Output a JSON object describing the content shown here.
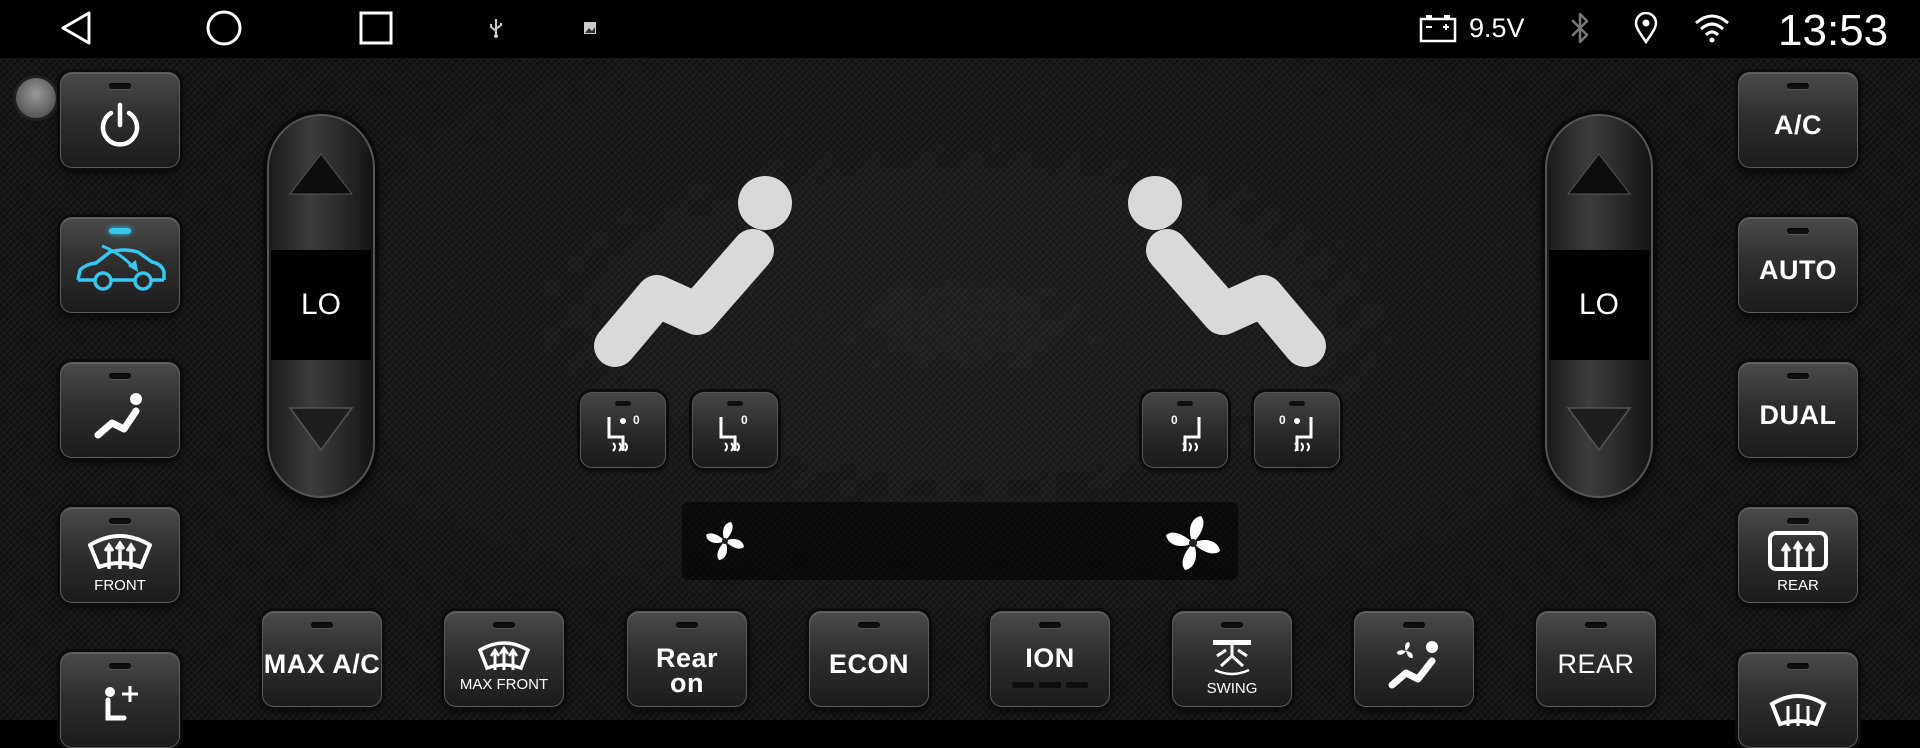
{
  "statusbar": {
    "icons": [
      "back-icon",
      "home-icon",
      "recents-icon",
      "usb-icon",
      "image-icon",
      "battery-icon",
      "bluetooth-icon",
      "location-icon",
      "wifi-icon"
    ],
    "voltage": "9.5V",
    "time": "13:53"
  },
  "left_column": {
    "buttons": [
      {
        "name": "power-button",
        "icon": "power-icon"
      },
      {
        "name": "recirculation-button",
        "icon": "car-recirculation-icon",
        "active": true
      },
      {
        "name": "seat-airflow-button",
        "icon": "seat-person-icon"
      },
      {
        "name": "front-defrost-button",
        "icon": "front-defrost-icon",
        "label": "FRONT"
      },
      {
        "name": "seat-add-button",
        "icon": "seat-plus-icon"
      }
    ]
  },
  "right_column": {
    "buttons": [
      {
        "name": "ac-button",
        "label": "A/C"
      },
      {
        "name": "auto-button",
        "label": "AUTO"
      },
      {
        "name": "dual-button",
        "label": "DUAL"
      },
      {
        "name": "rear-defrost-button",
        "icon": "rear-defrost-icon",
        "label": "REAR"
      },
      {
        "name": "defrost-button",
        "icon": "front-defrost-icon"
      }
    ]
  },
  "temperature": {
    "left": {
      "value": "LO"
    },
    "right": {
      "value": "LO"
    }
  },
  "seat_heat": {
    "left": [
      {
        "name": "seat-vent-left",
        "level": "0",
        "icon": "seat-fan-icon"
      },
      {
        "name": "seat-heat-left",
        "level": "0",
        "icon": "seat-heat-icon"
      }
    ],
    "right": [
      {
        "name": "seat-heat-right",
        "level": "0",
        "icon": "seat-heat-icon"
      },
      {
        "name": "seat-vent-right",
        "level": "0",
        "icon": "seat-fan-icon"
      }
    ]
  },
  "bottom_row": {
    "max_ac": "MAX A/C",
    "max_front": "MAX FRONT",
    "rear_on_line1": "Rear",
    "rear_on_line2": "on",
    "econ": "ECON",
    "ion": "ION",
    "swing": "SWING",
    "rear": "REAR"
  },
  "colors": {
    "accent": "#36c8f0",
    "background": "#161616",
    "button": "#2f2f2f"
  }
}
